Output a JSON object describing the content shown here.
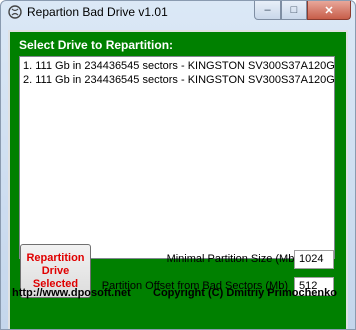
{
  "window": {
    "title": "Repartion Bad Drive v1.01",
    "minimize_glyph": "–",
    "maximize_glyph": "□",
    "close_glyph": "✕"
  },
  "drives": {
    "label": "Select Drive to Repartition:",
    "items": [
      "1. 111 Gb in 234436545 sectors  -  KINGSTON SV300S37A120G",
      "2. 111 Gb in 234436545 sectors  -  KINGSTON SV300S37A120G"
    ]
  },
  "actions": {
    "repartition_label": "Repartition\nDrive\nSelected"
  },
  "settings": {
    "min_partition_label": "Minimal Partition Size (Mb)",
    "min_partition_value": "1024",
    "offset_label": "Partition Offset from Bad Sectors (Mb)",
    "offset_value": "512"
  },
  "footer": {
    "url": "http://www.dposoft.net",
    "copyright": "Copyright (C) Dmitriy Primochenko"
  },
  "colors": {
    "group_bg": "#008000",
    "button_text": "#e00000"
  }
}
